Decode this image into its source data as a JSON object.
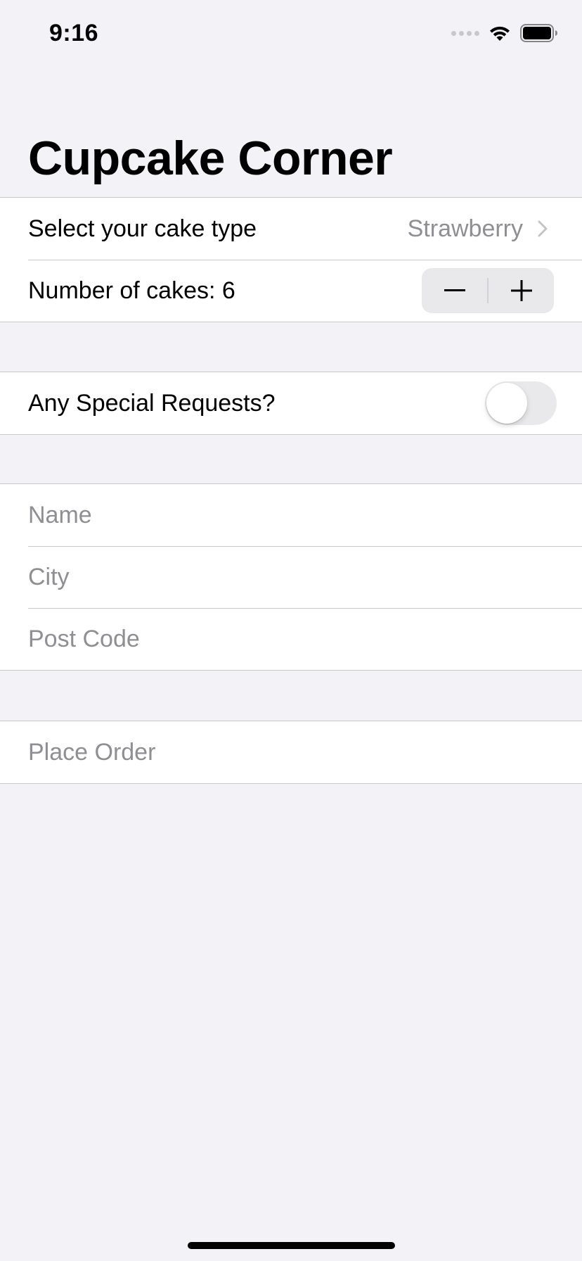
{
  "status_bar": {
    "time": "9:16"
  },
  "navigation": {
    "title": "Cupcake Corner"
  },
  "order_section": {
    "cake_type_label": "Select your cake type",
    "cake_type_value": "Strawberry",
    "quantity_label": "Number of cakes: 6",
    "quantity": 6
  },
  "special_section": {
    "special_requests_label": "Any Special Requests?",
    "special_requests_enabled": false
  },
  "address_section": {
    "name_placeholder": "Name",
    "city_placeholder": "City",
    "post_code_placeholder": "Post Code"
  },
  "checkout_section": {
    "place_order_label": "Place Order"
  },
  "colors": {
    "background": "#f2f2f7",
    "secondary_text": "#8e8e93",
    "separator": "#c8c7cc"
  },
  "icons": {
    "signal": "cellular-signal-icon",
    "wifi": "wifi-icon",
    "battery": "battery-icon",
    "chevron": "chevron-right-icon",
    "minus": "minus-icon",
    "plus": "plus-icon"
  }
}
